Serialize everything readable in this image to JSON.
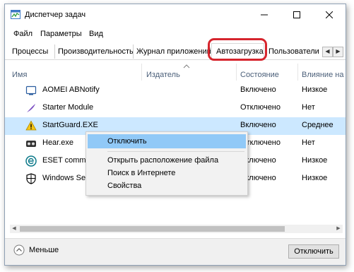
{
  "window": {
    "title": "Диспетчер задач",
    "icon": "task-manager-icon",
    "controls": {
      "minimize": "—",
      "maximize": "☐",
      "close": "✕"
    }
  },
  "menu": [
    "Файл",
    "Параметры",
    "Вид"
  ],
  "tabs": [
    "Процессы",
    "Производительность",
    "Журнал приложений",
    "Автозагрузка",
    "Пользователи"
  ],
  "active_tab": "Автозагрузка",
  "tab_scroll": {
    "left": "◀",
    "right": "▶"
  },
  "columns": {
    "name": "Имя",
    "publisher": "Издатель",
    "status": "Состояние",
    "impact": "Влияние на з"
  },
  "rows": [
    {
      "name": "AOMEI ABNotify",
      "publisher": "",
      "status": "Включено",
      "impact": "Низкое",
      "icon": "aomei-icon"
    },
    {
      "name": "Starter Module",
      "publisher": "",
      "status": "Отключено",
      "impact": "Нет",
      "icon": "starter-feather-icon"
    },
    {
      "name": "StartGuard.EXE",
      "publisher": "",
      "status": "Включено",
      "impact": "Среднее",
      "icon": "warning-icon"
    },
    {
      "name": "Hear.exe",
      "publisher": "",
      "status": "Отключено",
      "impact": "Нет",
      "icon": "hear-icon"
    },
    {
      "name": "ESET comma",
      "publisher": "",
      "status": "Включено",
      "impact": "Низкое",
      "icon": "eset-icon"
    },
    {
      "name": "Windows Se",
      "publisher": "",
      "status": "Включено",
      "impact": "Низкое",
      "icon": "windows-security-shield-icon"
    }
  ],
  "context_menu": [
    "Отключить",
    "Открыть расположение файла",
    "Поиск в Интернете",
    "Свойства"
  ],
  "footer": {
    "fewer_label": "Меньше",
    "disable_button": "Отключить"
  },
  "colors": {
    "highlight_ring": "#d6252d",
    "selected_row": "#cce8ff",
    "menu_hover": "#91c9f7"
  }
}
